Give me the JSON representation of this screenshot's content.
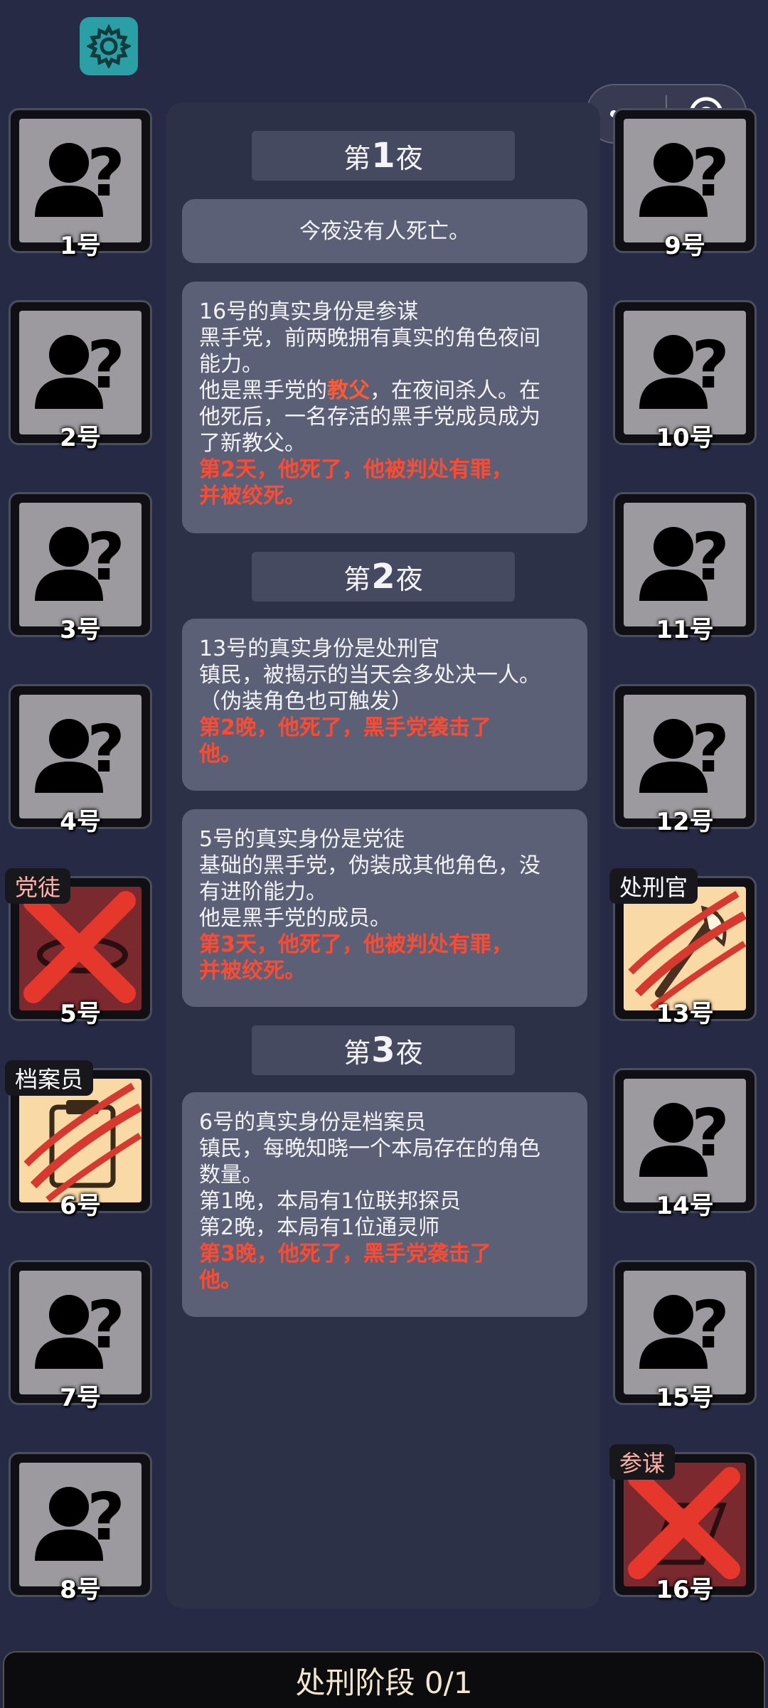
{
  "window": {
    "menu_icon": "more-dots-icon",
    "close_icon": "record-circle-icon"
  },
  "settings_icon": "gear-icon",
  "nights": [
    {
      "prefix": "第",
      "num": "1",
      "suffix": "夜"
    },
    {
      "prefix": "第",
      "num": "2",
      "suffix": "夜"
    },
    {
      "prefix": "第",
      "num": "3",
      "suffix": "夜"
    }
  ],
  "log": {
    "no_death": "今夜没有人死亡。",
    "c1": {
      "l1": "16号的真实身份是参谋",
      "l2": "黑手党，前两晚拥有真实的角色夜间",
      "l3": "能力。",
      "l4a": "他是黑手党的",
      "l4b": "教父",
      "l4c": "，在夜间杀人。在",
      "l5": "他死后，一名存活的黑手党成员成为",
      "l6": "了新教父。",
      "r1": "第2天，他死了，他被判处有罪，",
      "r2": "并被绞死。"
    },
    "c2": {
      "l1": "13号的真实身份是处刑官",
      "l2": "镇民，被揭示的当天会多处决一人。",
      "l3": "（伪装角色也可触发）",
      "r1": "第2晚，他死了，黑手党袭击了",
      "r2": "他。"
    },
    "c3": {
      "l1": "5号的真实身份是党徒",
      "l2": "基础的黑手党，伪装成其他角色，没",
      "l3": "有进阶能力。",
      "l4": "他是黑手党的成员。",
      "r1": "第3天，他死了，他被判处有罪，",
      "r2": "并被绞死。"
    },
    "c4": {
      "l1": "6号的真实身份是档案员",
      "l2": "镇民，每晚知晓一个本局存在的角色",
      "l3": "数量。",
      "l4": "第1晚，本局有1位联邦探员",
      "l5": "第2晚，本局有1位通灵师",
      "r1": "第3晚，他死了，黑手党袭击了",
      "r2": "他。"
    }
  },
  "players": [
    {
      "label": "1号",
      "state": "unknown"
    },
    {
      "label": "2号",
      "state": "unknown"
    },
    {
      "label": "3号",
      "state": "unknown"
    },
    {
      "label": "4号",
      "state": "unknown"
    },
    {
      "label": "5号",
      "state": "dead",
      "role": "党徒"
    },
    {
      "label": "6号",
      "state": "dead",
      "role": "档案员"
    },
    {
      "label": "7号",
      "state": "unknown"
    },
    {
      "label": "8号",
      "state": "unknown"
    },
    {
      "label": "9号",
      "state": "unknown"
    },
    {
      "label": "10号",
      "state": "unknown"
    },
    {
      "label": "11号",
      "state": "unknown"
    },
    {
      "label": "12号",
      "state": "unknown"
    },
    {
      "label": "13号",
      "state": "dead",
      "role": "处刑官"
    },
    {
      "label": "14号",
      "state": "unknown"
    },
    {
      "label": "15号",
      "state": "unknown"
    },
    {
      "label": "16号",
      "state": "dead",
      "role": "参谋"
    }
  ],
  "phase": {
    "text": "处刑阶段 0/1"
  },
  "colors": {
    "accent_red": "#ff4a32",
    "gear_bg": "#2aa0a6",
    "card_bg": "#5b6076"
  }
}
